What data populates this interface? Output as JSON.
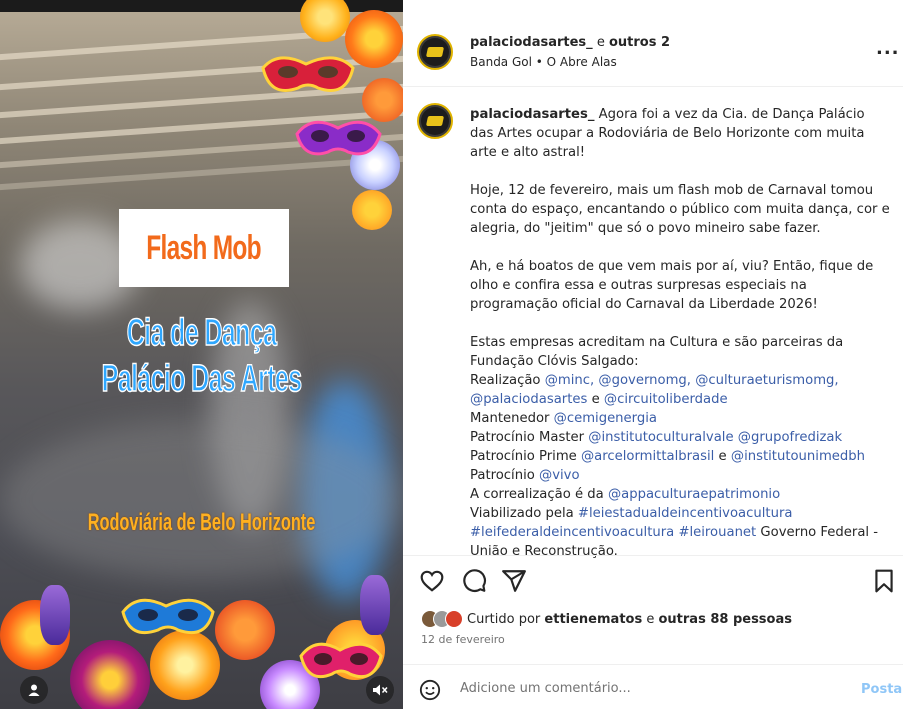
{
  "media": {
    "title": "Flash Mob",
    "line1": "Cia de Dança",
    "line2": "Palácio Das Artes",
    "location": "Rodoviária de Belo Horizonte",
    "user_icon": "user-tag-icon",
    "mute_icon": "speaker-muted-icon"
  },
  "header": {
    "username": "palaciodasartes_",
    "and": "e",
    "others": "outros 2",
    "subtitle": "Banda Gol • O Abre Alas",
    "more": "..."
  },
  "caption": {
    "username": "palaciodasartes_",
    "p1": "Agora foi a vez da Cia. de Dança Palácio das Artes ocupar a Rodoviária de Belo Horizonte com muita arte e alto astral!",
    "p2": "Hoje, 12 de fevereiro, mais um flash mob de Carnaval tomou conta do espaço, encantando o público com muita dança, cor e alegria, do \"jeitim\" que só o povo mineiro sabe fazer.",
    "p3": "Ah, e há boatos de que vem mais por aí, viu? Então, fique de olho e confira essa e outras surpresas especiais na programação oficial do Carnaval da Liberdade 2026!",
    "p4_intro": "Estas empresas acreditam na Cultura e são parceiras da Fundação Clóvis Salgado:",
    "realizacao_label": "Realização",
    "m_minc": "@minc,",
    "m_governomg": "@governomg,",
    "m_culturaeturismomg": "@culturaeturismomg,",
    "m_palaciodasartes": "@palaciodasartes",
    "e1": "e",
    "m_circuitoliberdade": "@circuitoliberdade",
    "mantenedor_label": "Mantenedor",
    "m_cemigenergia": "@cemigenergia",
    "master_label": "Patrocínio Master",
    "m_institutoculturalvale": "@institutoculturalvale",
    "m_grupofredizak": "@grupofredizak",
    "prime_label": "Patrocínio Prime",
    "m_arcelormittalbrasil": "@arcelormittalbrasil",
    "e2": "e",
    "m_institutounimedbh": "@institutounimedbh",
    "patrocinio_label": "Patrocínio",
    "m_vivo": "@vivo",
    "correal_label": "A correalização é da",
    "m_appaculturaepatrimonio": "@appaculturaepatrimonio",
    "viabilizado_label": "Viabilizado pela",
    "h_leiestadual": "#leiestadualdeincentivoacultura",
    "h_leifederal": "#leifederaldeincentivoacultura",
    "h_leirouanet": "#leirouanet",
    "governo": "Governo Federal -",
    "uniao": "União e Reconstrução."
  },
  "actions": {
    "like_icon": "heart-icon",
    "comment_icon": "comment-bubble-icon",
    "share_icon": "paper-plane-icon",
    "save_icon": "bookmark-icon"
  },
  "likes": {
    "prefix": "Curtido por",
    "user": "ettienematos",
    "and": "e",
    "others": "outras 88 pessoas"
  },
  "date": "12 de fevereiro",
  "comment": {
    "placeholder": "Adicione um comentário...",
    "post": "Postar",
    "emoji_icon": "smiley-icon"
  },
  "colors": {
    "mention": "#3b5ea8",
    "post_disabled": "#8fc6f7",
    "title_orange": "#f26a1b",
    "cia_blue": "#2ea7ff",
    "location_yellow": "#ffb020"
  }
}
